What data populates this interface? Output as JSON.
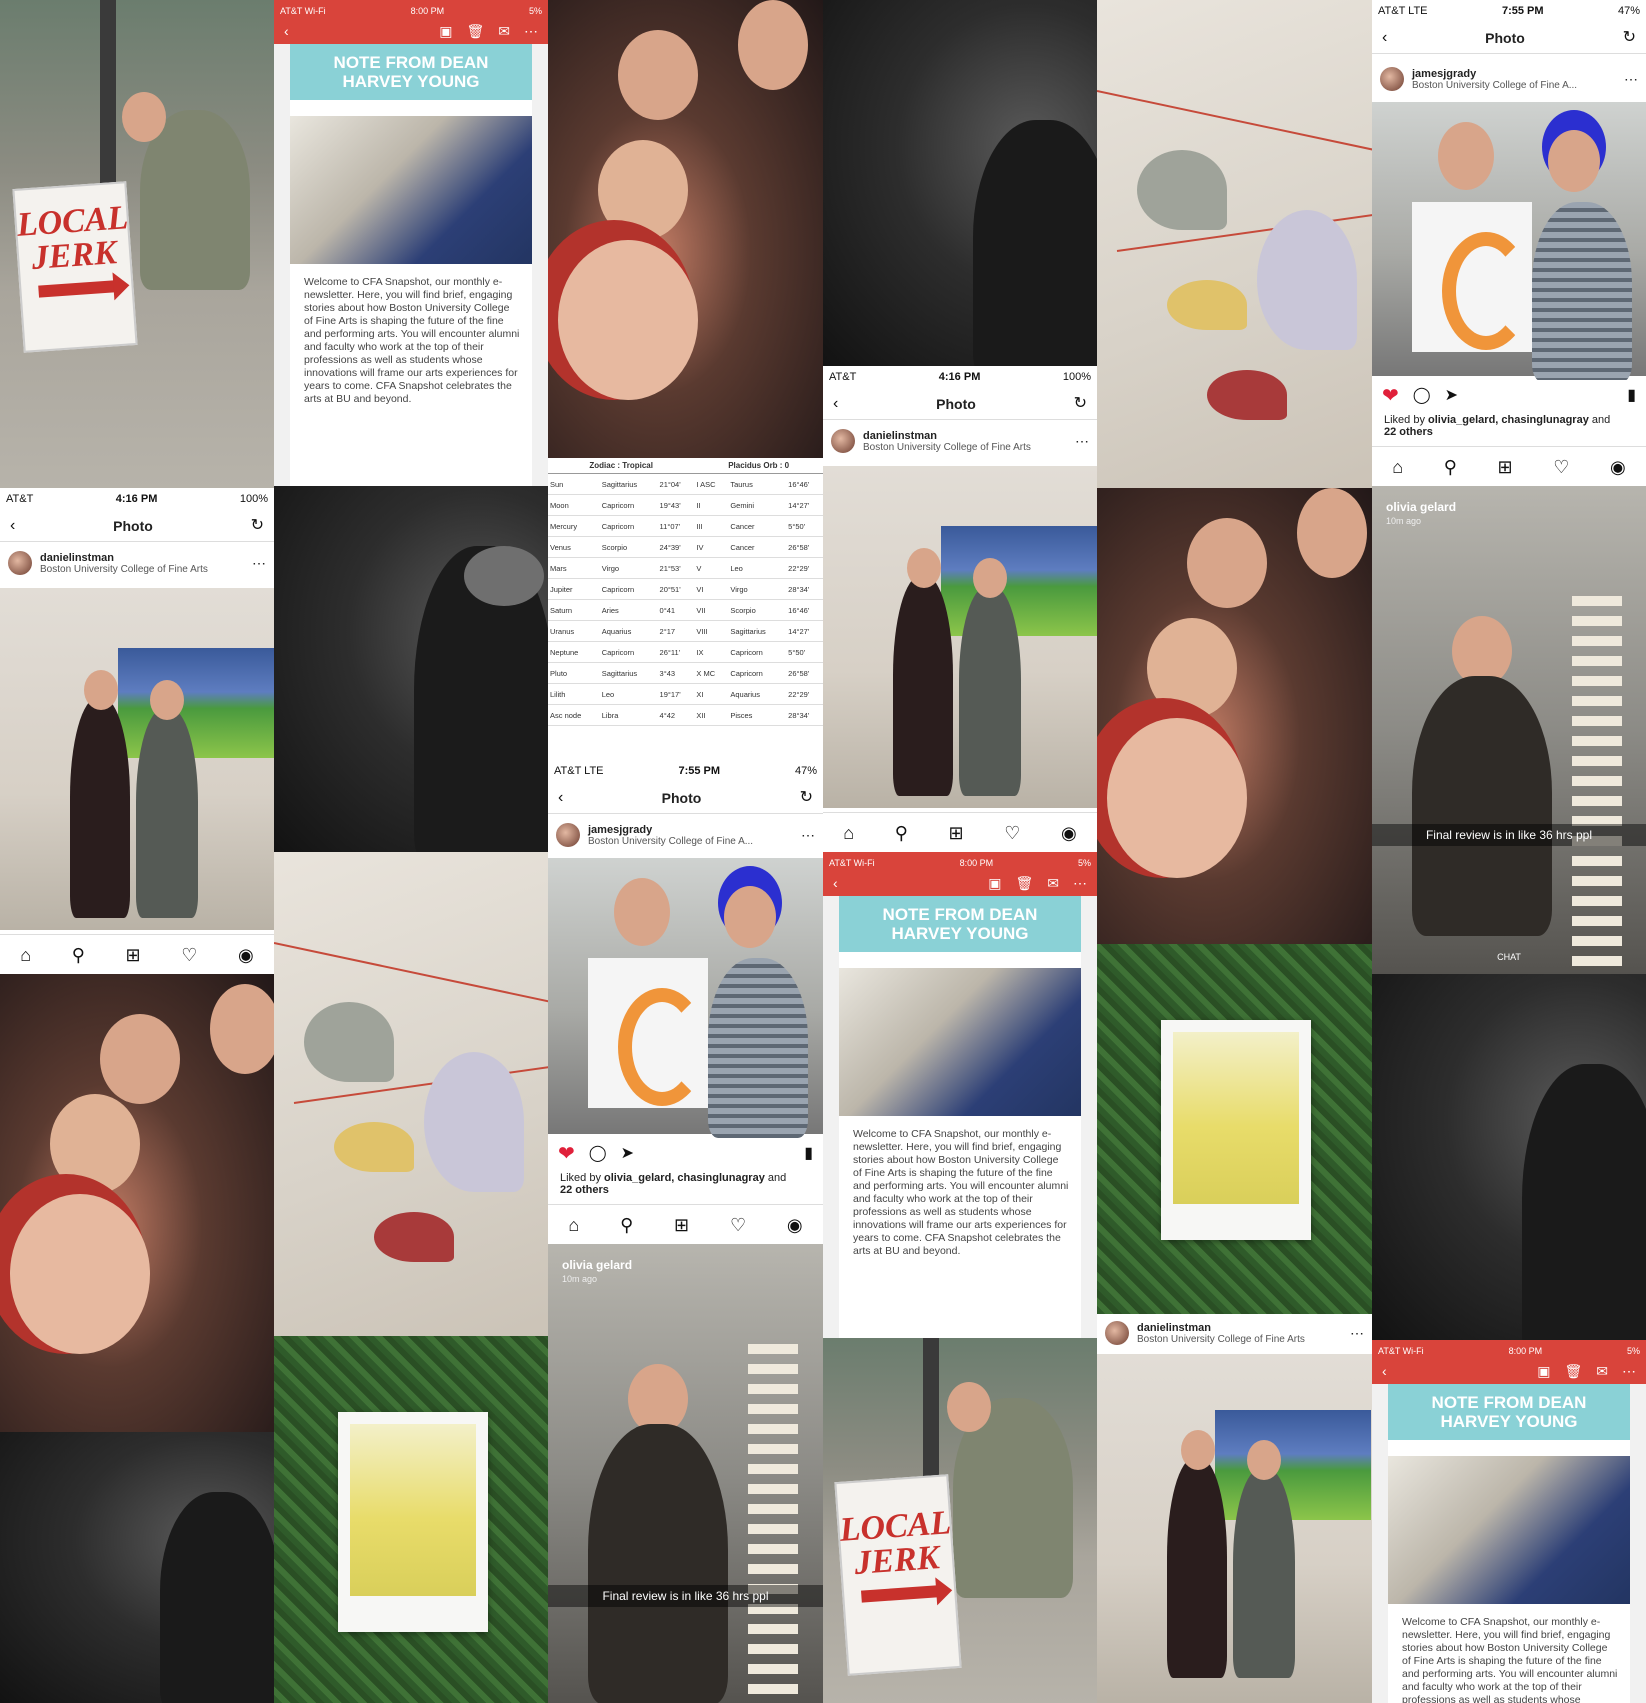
{
  "status_ios_att": {
    "carrier": "AT&T",
    "time": "4:16 PM",
    "battery": "100%"
  },
  "status_ios_lte": {
    "carrier": "AT&T  LTE",
    "time": "7:55 PM",
    "battery": "47%"
  },
  "status_gmail": {
    "carrier": "AT&T Wi-Fi",
    "time": "8:00 PM",
    "battery": "5%"
  },
  "photo_title": "Photo",
  "post_danielle": {
    "username": "danielinstman",
    "subtitle": "Boston University College of Fine Arts"
  },
  "post_james": {
    "username": "jamesjgrady",
    "subtitle": "Boston University College of Fine A...",
    "liked_prefix": "Liked by ",
    "liked_users": "olivia_gelard, chasinglunagray",
    "liked_suffix": " and",
    "liked_others": "22 others"
  },
  "newsletter": {
    "banner": "NOTE FROM DEAN\nHARVEY YOUNG",
    "body": "Welcome to CFA Snapshot, our monthly e-newsletter. Here, you will find brief, engaging stories about how Boston University College of Fine Arts is shaping the future of the fine and performing arts. You will encounter alumni and faculty who work at the top of their professions as well as students whose innovations will frame our arts experiences for years to come. CFA Snapshot celebrates the arts at BU and beyond."
  },
  "sign_text": {
    "line1": "LOCAL",
    "line2": "JERK"
  },
  "snap": {
    "name": "olivia gelard",
    "ago": "10m ago",
    "caption": "Final review is in like 36 hrs ppl",
    "chat": "CHAT"
  },
  "zodiac": {
    "header_left": "Zodiac : Tropical",
    "header_right": "Placidus Orb : 0",
    "planets": [
      {
        "name": "Sun",
        "sign": "Sagittarius",
        "deg": "21°04'"
      },
      {
        "name": "Moon",
        "sign": "Capricorn",
        "deg": "19°43'"
      },
      {
        "name": "Mercury",
        "sign": "Capricorn",
        "deg": "11°07'"
      },
      {
        "name": "Venus",
        "sign": "Scorpio",
        "deg": "24°39'"
      },
      {
        "name": "Mars",
        "sign": "Virgo",
        "deg": "21°53'"
      },
      {
        "name": "Jupiter",
        "sign": "Capricorn",
        "deg": "20°51'"
      },
      {
        "name": "Saturn",
        "sign": "Aries",
        "deg": "0°41"
      },
      {
        "name": "Uranus",
        "sign": "Aquarius",
        "deg": "2°17"
      },
      {
        "name": "Neptune",
        "sign": "Capricorn",
        "deg": "26°11'"
      },
      {
        "name": "Pluto",
        "sign": "Sagittarius",
        "deg": "3°43"
      },
      {
        "name": "Lilith",
        "sign": "Leo",
        "deg": "19°17'"
      },
      {
        "name": "Asc node",
        "sign": "Libra",
        "deg": "4°42"
      }
    ],
    "houses": [
      {
        "house": "I ASC",
        "sign": "Taurus",
        "deg": "16°46'"
      },
      {
        "house": "II",
        "sign": "Gemini",
        "deg": "14°27'"
      },
      {
        "house": "III",
        "sign": "Cancer",
        "deg": "5°50'"
      },
      {
        "house": "IV",
        "sign": "Cancer",
        "deg": "26°58'"
      },
      {
        "house": "V",
        "sign": "Leo",
        "deg": "22°29'"
      },
      {
        "house": "VI",
        "sign": "Virgo",
        "deg": "28°34'"
      },
      {
        "house": "VII",
        "sign": "Scorpio",
        "deg": "16°46'"
      },
      {
        "house": "VIII",
        "sign": "Sagittarius",
        "deg": "14°27'"
      },
      {
        "house": "IX",
        "sign": "Capricorn",
        "deg": "5°50'"
      },
      {
        "house": "X MC",
        "sign": "Capricorn",
        "deg": "26°58'"
      },
      {
        "house": "XI",
        "sign": "Aquarius",
        "deg": "22°29'"
      },
      {
        "house": "XII",
        "sign": "Pisces",
        "deg": "28°34'"
      }
    ]
  },
  "colors": {
    "gmail_red": "#d9443b",
    "banner_teal": "#8ad1d6",
    "like_red": "#e0203a"
  },
  "icons": [
    "back-icon",
    "refresh-icon",
    "home-icon",
    "search-icon",
    "add-icon",
    "heart-icon",
    "profile-icon",
    "comment-icon",
    "share-icon",
    "bookmark-icon",
    "archive-icon",
    "trash-icon",
    "mail-icon",
    "more-icon"
  ]
}
